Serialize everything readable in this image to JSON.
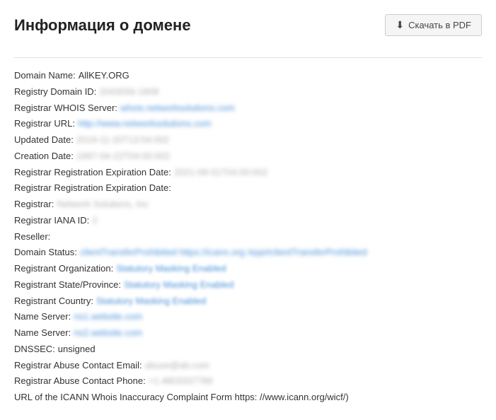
{
  "header": {
    "title": "Информация о домене",
    "pdf_button": "Скачать в PDF"
  },
  "whois": {
    "domain_name_label": "Domain Name:",
    "domain_name_value": "AllKEY.ORG",
    "registry_id_label": "Registry Domain ID:",
    "registry_id_value": "2043056-1808",
    "registrar_whois_label": "Registrar WHOIS Server:",
    "registrar_whois_value": "whois.networksolutions.com",
    "registrar_url_label": "Registrar URL:",
    "registrar_url_value": "http://www.networksolutions.com",
    "updated_date_label": "Updated Date:",
    "updated_date_value": "2019-11-20T13:54:002",
    "creation_date_label": "Creation Date:",
    "creation_date_value": "1997-04-22T04:00:002",
    "expiration_date1_label": "Registrar Registration Expiration Date:",
    "expiration_date1_value": "2021-09-01T04:00:002",
    "expiration_date2_label": "Registrar Registration Expiration Date:",
    "registrar_label": "Registrar:",
    "registrar_value": "Network Solutions, Inc",
    "iana_label": "Registrar IANA ID:",
    "iana_value": "2",
    "reseller_label": "Reseller:",
    "domain_status_label": "Domain Status:",
    "domain_status_value": "clientTransferProhibited https://icann.org /epp#clientTransferProhibited",
    "reg_org_label": "Registrant Organization:",
    "reg_org_value": "Statutory Masking Enabled",
    "reg_state_label": "Registrant State/Province:",
    "reg_state_value": "Statutory Masking Enabled",
    "reg_country_label": "Registrant Country:",
    "reg_country_value": "Statutory Masking Enabled",
    "ns1_label": "Name Server:",
    "ns1_value": "ns1.website.com",
    "ns2_label": "Name Server:",
    "ns2_value": "ns2.website.com",
    "dnssec_label": "DNSSEC:",
    "dnssec_value": "unsigned",
    "abuse_email_label": "Registrar Abuse Contact Email:",
    "abuse_email_value": "abuse@ab.com",
    "abuse_phone_label": "Registrar Abuse Contact Phone:",
    "abuse_phone_value": "+1.4803337789",
    "icann_label": "URL of the ICANN Whois Inaccuracy Complaint Form https: //www.icann.org/wicf/)"
  }
}
